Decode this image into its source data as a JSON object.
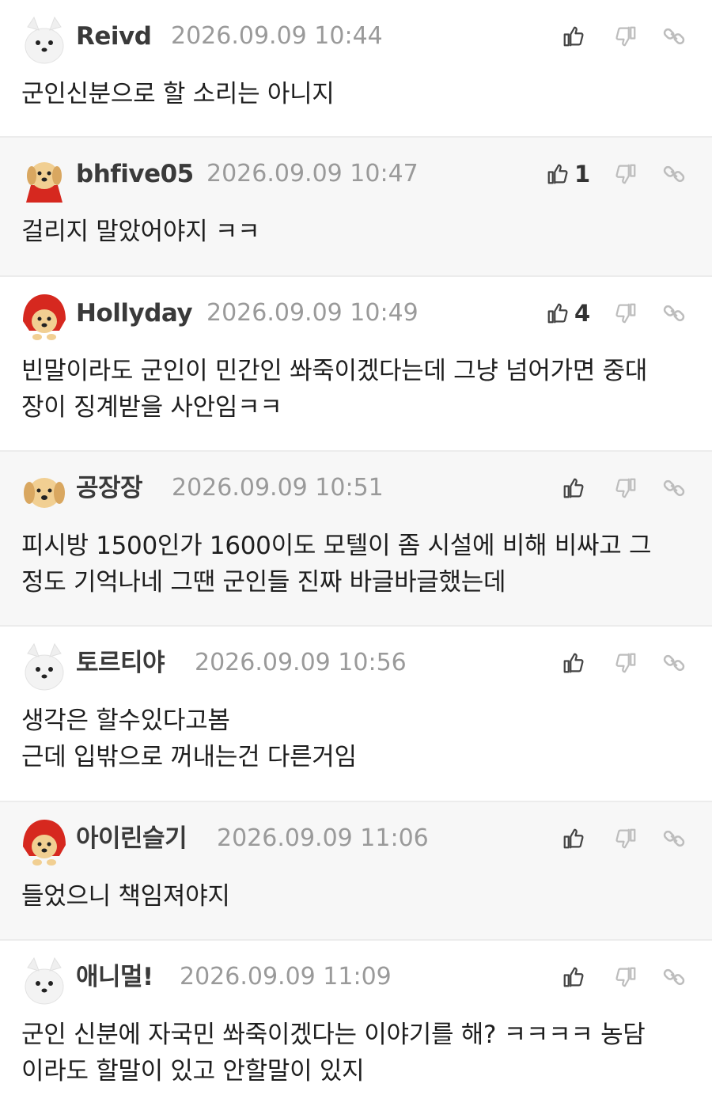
{
  "comments": [
    {
      "author": "Reivd",
      "time": "2026.09.09 10:44",
      "likes": "",
      "text": "군인신분으로 할 소리는 아니지",
      "avatar": "white-dog-avatar"
    },
    {
      "author": "bhfive05",
      "time": "2026.09.09 10:47",
      "likes": "1",
      "text": "걸리지 말았어야지 ㅋㅋ",
      "avatar": "puppy-red-cape-avatar"
    },
    {
      "author": "Hollyday",
      "time": "2026.09.09 10:49",
      "likes": "4",
      "text": "빈말이라도 군인이 민간인 쏴죽이겠다는데 그냥 넘어가면 중대\n장이 징계받을 사안임ㅋㅋ",
      "avatar": "puppy-red-hood-avatar"
    },
    {
      "author": "공장장",
      "time": "2026.09.09 10:51",
      "likes": "",
      "text": "피시방 1500인가 1600이도 모텔이 좀 시설에 비해 비싸고 그\n정도 기억나네 그땐 군인들 진짜 바글바글했는데",
      "avatar": "puppy-avatar"
    },
    {
      "author": "토르티야",
      "time": "2026.09.09 10:56",
      "likes": "",
      "text": "생각은 할수있다고봄\n근데 입밖으로 꺼내는건 다른거임",
      "avatar": "white-dog-avatar"
    },
    {
      "author": "아이린슬기",
      "time": "2026.09.09 11:06",
      "likes": "",
      "text": "들었으니 책임져야지",
      "avatar": "puppy-red-hood-avatar"
    },
    {
      "author": "애니멀!",
      "time": "2026.09.09 11:09",
      "likes": "",
      "text": "군인 신분에 자국민 쏴죽이겠다는 이야기를 해? ㅋㅋㅋㅋ 농담\n이라도 할말이 있고 안할말이 있지",
      "avatar": "white-dog-avatar"
    }
  ],
  "colors": {
    "background": "#ffffff",
    "alt_background": "#f7f7f7",
    "author": "#3a3a3a",
    "time": "#9a9a9a",
    "icon": "#444444",
    "icon_muted": "#bdbdbd"
  }
}
